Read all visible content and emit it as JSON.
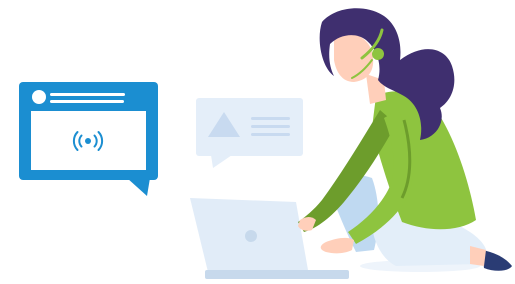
{
  "illustration": {
    "subject": "woman-working-on-laptop",
    "colors": {
      "brand_blue": "#1b8ed1",
      "pale_blue": "#e4eef9",
      "laptop_body": "#e1ecf8",
      "laptop_base": "#c7d9ec",
      "hair": "#3f2f6f",
      "skin": "#ffcfba",
      "sweater": "#8ec43f",
      "sweater_shadow": "#6d9d2c",
      "jeans": "#bfd9f1",
      "shoe": "#2a3c74",
      "headset": "#8ec43f"
    },
    "icons": {
      "broadcast": "broadcast-icon",
      "alert": "warning-triangle-icon"
    }
  }
}
